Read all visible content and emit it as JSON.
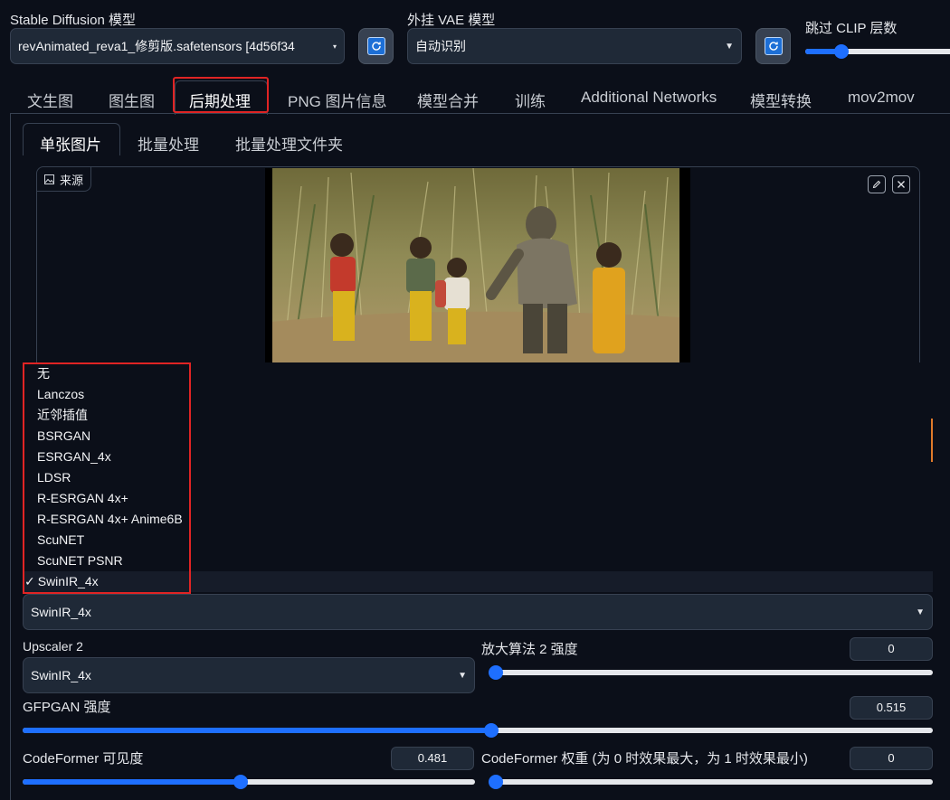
{
  "header": {
    "sd_model_label": "Stable Diffusion 模型",
    "sd_model_value": "revAnimated_reva1_修剪版.safetensors [4d56f34",
    "vae_label": "外挂 VAE 模型",
    "vae_value": "自动识别",
    "clip_label": "跳过 CLIP 层数",
    "clip_value": 0.2
  },
  "tabs": [
    "文生图",
    "图生图",
    "后期处理",
    "PNG 图片信息",
    "模型合并",
    "训练",
    "Additional Networks",
    "模型转换",
    "mov2mov"
  ],
  "active_tab": "后期处理",
  "subtabs": [
    "单张图片",
    "批量处理",
    "批量处理文件夹"
  ],
  "source": {
    "label": "来源",
    "image_description": "video still: children in yellow outfits beside a large creature figure in tall grass"
  },
  "upscaler_dropdown": {
    "options": [
      "无",
      "Lanczos",
      "近邻插值",
      "BSRGAN",
      "ESRGAN_4x",
      "LDSR",
      "R-ESRGAN 4x+",
      "R-ESRGAN 4x+ Anime6B",
      "ScuNET",
      "ScuNET PSNR",
      "SwinIR_4x"
    ],
    "selected": "SwinIR_4x",
    "check": "✓"
  },
  "upscaler1_value": "SwinIR_4x",
  "upscaler2": {
    "label": "Upscaler 2",
    "value": "SwinIR_4x"
  },
  "upscaler2_strength": {
    "label": "放大算法 2 强度",
    "value": "0",
    "fraction": 0
  },
  "gfpgan": {
    "label": "GFPGAN 强度",
    "value": "0.515",
    "fraction": 0.515
  },
  "codeformer_visibility": {
    "label": "CodeFormer 可见度",
    "value": "0.481",
    "fraction": 0.481
  },
  "codeformer_weight": {
    "label": "CodeFormer 权重 (为 0 时效果最大，为 1 时效果最小)",
    "value": "0",
    "fraction": 0
  },
  "colors": {
    "accent": "#1e6fff",
    "highlight_box": "#e02424",
    "background": "#0b0f19"
  },
  "icons": {
    "refresh": "refresh-icon",
    "image": "image-icon",
    "edit": "pencil-icon",
    "close": "close-icon",
    "dropdown": "chevron-down-icon"
  }
}
